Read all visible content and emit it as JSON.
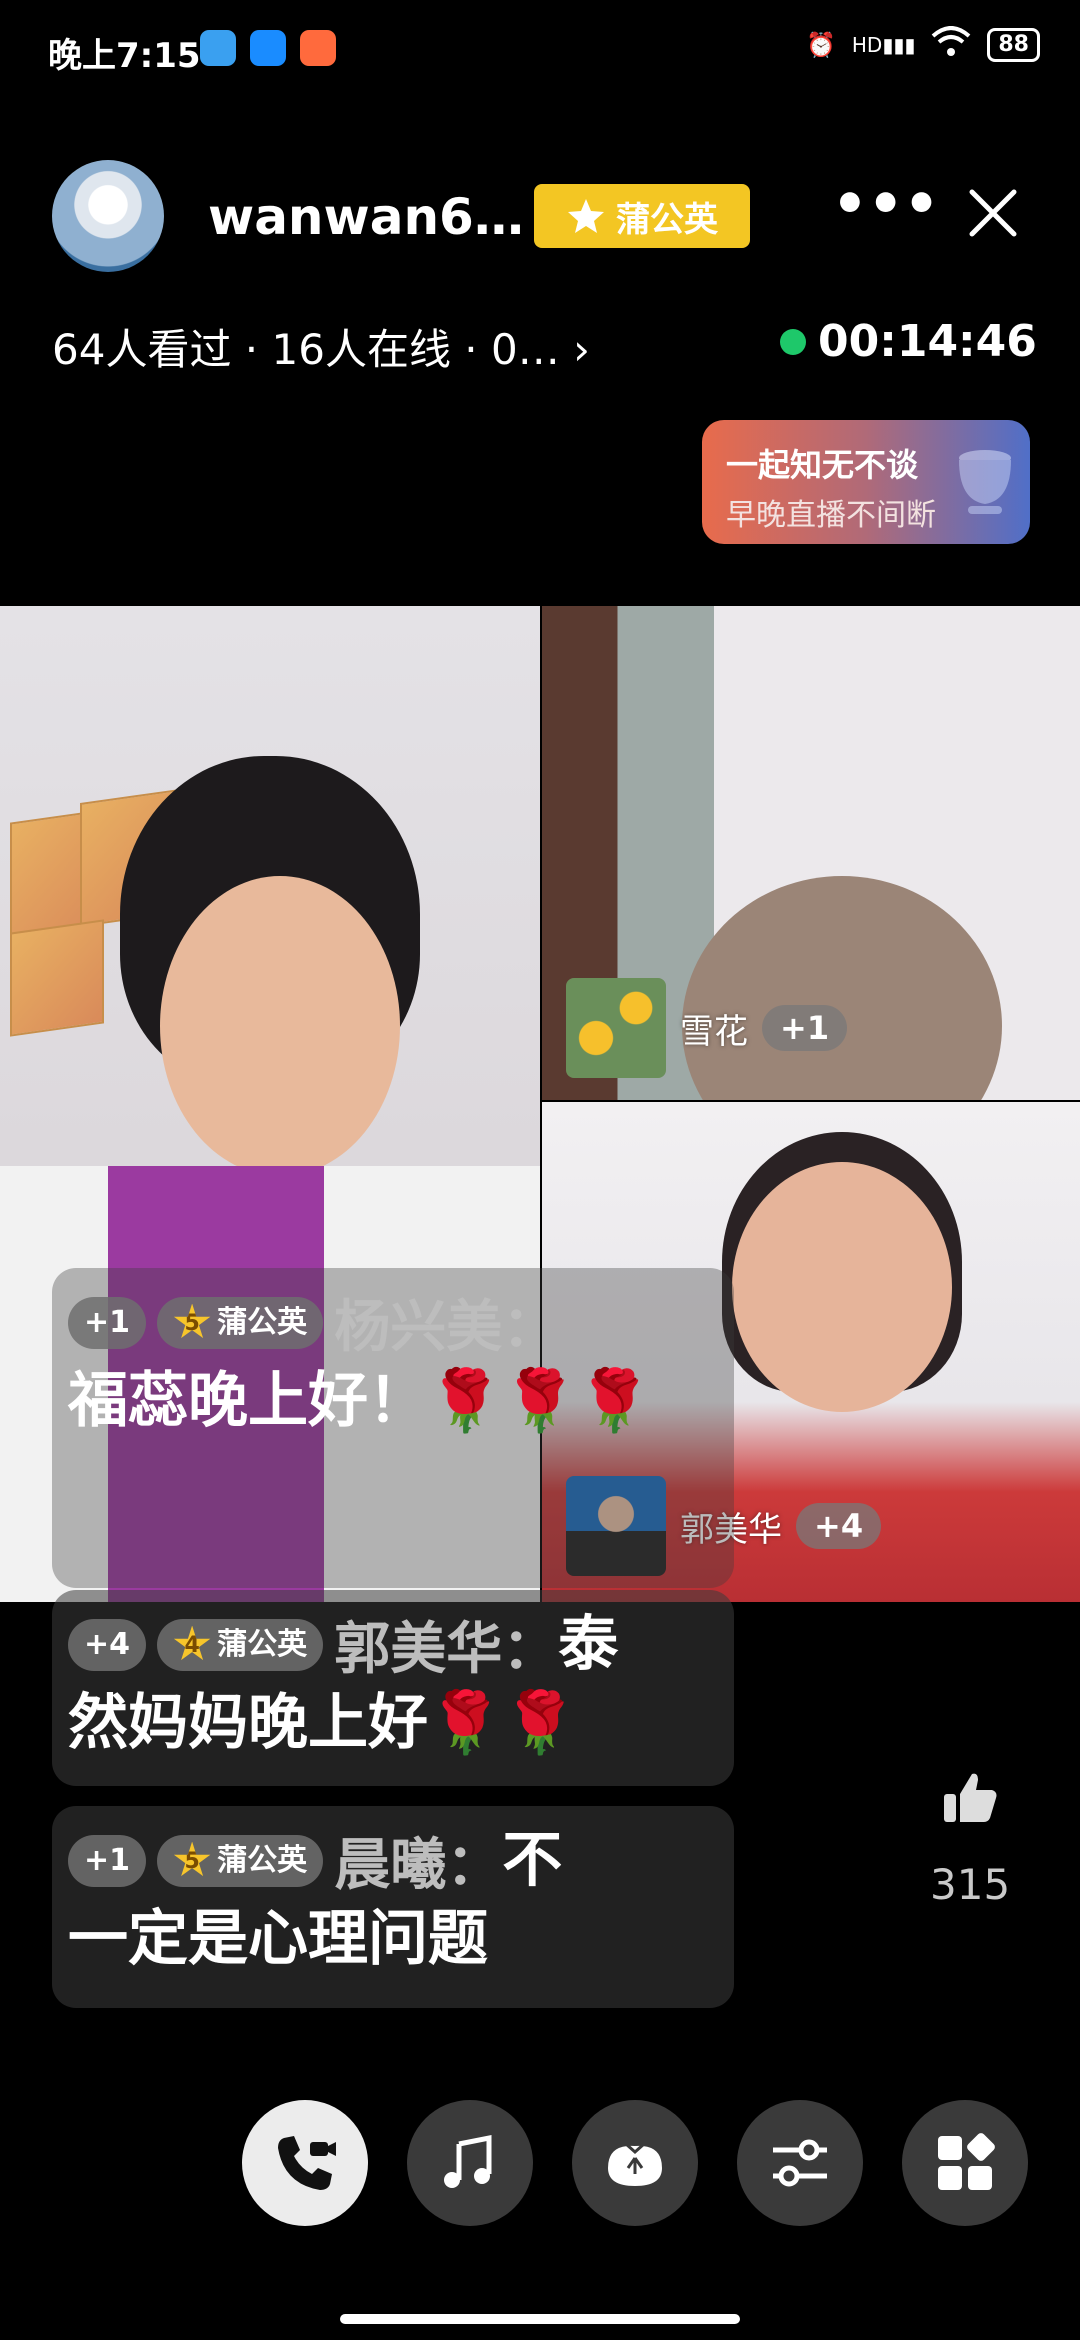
{
  "status_bar": {
    "time": "晚上7:15",
    "battery": "88",
    "network": "HD"
  },
  "header": {
    "username": "wanwan6…",
    "badge_label": "蒲公英",
    "stats": "64人看过 · 16人在线 · 0… ›",
    "timer": "00:14:46"
  },
  "promo": {
    "line1": "一起知无不谈",
    "line2": "早晚直播不间断"
  },
  "guests": [
    {
      "name": "雪花",
      "count": "+1"
    },
    {
      "name": "郭美华",
      "count": "+4"
    }
  ],
  "chat": [
    {
      "chip": "+1",
      "level": "5",
      "badge": "蒲公英",
      "sender": "杨兴美：",
      "message": "福蕊晚上好！🌹🌹🌹"
    },
    {
      "chip": "+4",
      "level": "4",
      "badge": "蒲公英",
      "sender": "郭美华：",
      "message_start": "泰",
      "message": "然妈妈晚上好🌹🌹"
    },
    {
      "chip": "+1",
      "level": "5",
      "badge": "蒲公英",
      "sender": "晨曦：",
      "message_start": "不",
      "message": "一定是心理问题"
    }
  ],
  "likes": {
    "count": "315"
  },
  "toolbar": [
    "call-icon",
    "music-icon",
    "gift-bag-icon",
    "settings-sliders-icon",
    "apps-grid-icon"
  ],
  "colors": {
    "badge": "#f3c623",
    "live": "#1ec86a",
    "star": "#f7c52b"
  }
}
